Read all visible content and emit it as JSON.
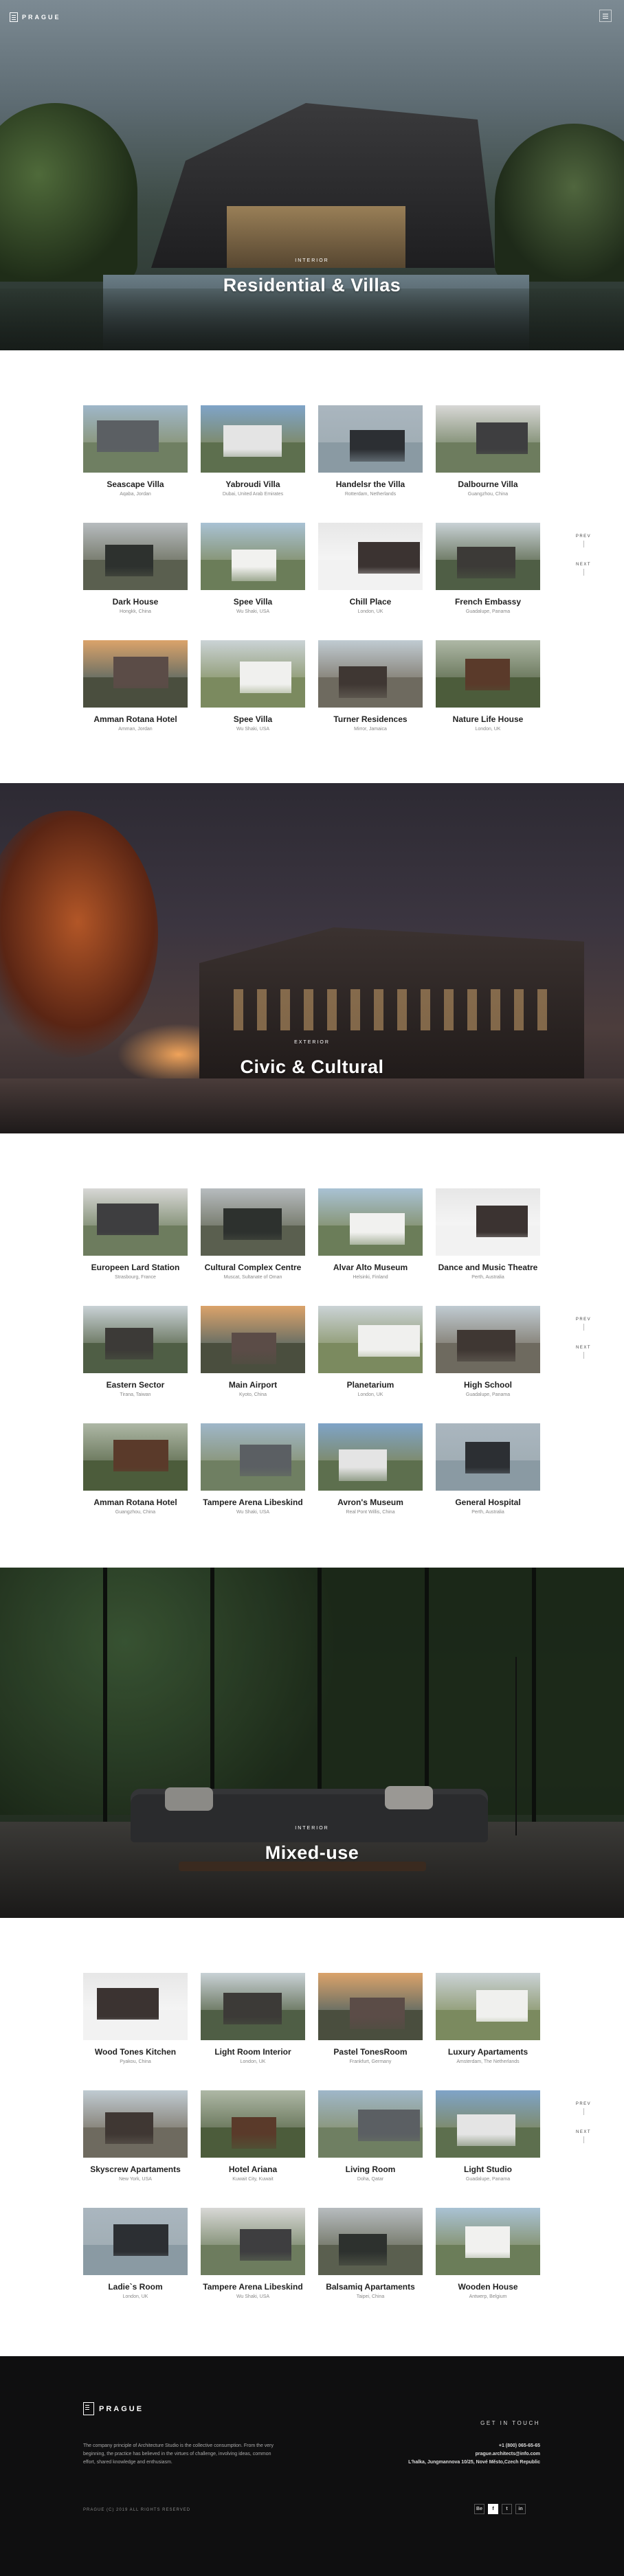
{
  "header": {
    "logo_text": "PRAGUE",
    "menu_icon": "hamburger-icon"
  },
  "sections": [
    {
      "eyebrow": "INTERIOR",
      "title": "Residential & Villas",
      "projects": [
        {
          "title": "Seascape Villa",
          "location": "Aqaba, Jordan"
        },
        {
          "title": "Yabroudi Villa",
          "location": "Dubai, United Arab Emirates"
        },
        {
          "title": "Handelsr the Villa",
          "location": "Rotterdam, Netherlands"
        },
        {
          "title": "Dalbourne Villa",
          "location": "Guangzhou, China"
        },
        {
          "title": "Dark House",
          "location": "Hongkk, China"
        },
        {
          "title": "Spee Villa",
          "location": "Wu Shaki, USA"
        },
        {
          "title": "Chill Place",
          "location": "London, UK"
        },
        {
          "title": "French Embassy",
          "location": "Guadalupe, Panama"
        },
        {
          "title": "Amman Rotana Hotel",
          "location": "Amman, Jordan"
        },
        {
          "title": "Spee Villa",
          "location": "Wu Shaki, USA"
        },
        {
          "title": "Turner Residences",
          "location": "Mirror, Jamaica"
        },
        {
          "title": "Nature Life House",
          "location": "London, UK"
        }
      ]
    },
    {
      "eyebrow": "EXTERIOR",
      "title": "Civic & Cultural",
      "projects": [
        {
          "title": "Europeen Lard Station",
          "location": "Strasbourg, France"
        },
        {
          "title": "Cultural Complex Centre",
          "location": "Muscat, Sultanate of Oman"
        },
        {
          "title": "Alvar Alto Museum",
          "location": "Helsinki, Finland"
        },
        {
          "title": "Dance and Music Theatre",
          "location": "Perth, Australia"
        },
        {
          "title": "Eastern Sector",
          "location": "Tirana, Taiwan"
        },
        {
          "title": "Main Airport",
          "location": "Kyoto, China"
        },
        {
          "title": "Planetarium",
          "location": "London, UK"
        },
        {
          "title": "High School",
          "location": "Guadalupe, Panama"
        },
        {
          "title": "Amman Rotana Hotel",
          "location": "Guangzhou, China"
        },
        {
          "title": "Tampere Arena Libeskind",
          "location": "Wu Shaki, USA"
        },
        {
          "title": "Avron's Museum",
          "location": "Real Pont Willis, China"
        },
        {
          "title": "General Hospital",
          "location": "Perth, Australia"
        }
      ]
    },
    {
      "eyebrow": "INTERIOR",
      "title": "Mixed-use",
      "projects": [
        {
          "title": "Wood Tones Kitchen",
          "location": "Pyakou, China"
        },
        {
          "title": "Light Room Interior",
          "location": "London, UK"
        },
        {
          "title": "Pastel TonesRoom",
          "location": "Frankfurt, Germany"
        },
        {
          "title": "Luxury Apartaments",
          "location": "Amsterdam, The Netherlands"
        },
        {
          "title": "Skyscrew Apartaments",
          "location": "New York, USA"
        },
        {
          "title": "Hotel Ariana",
          "location": "Kuwait City, Kuwait"
        },
        {
          "title": "Living Room",
          "location": "Doha, Qatar"
        },
        {
          "title": "Light Studio",
          "location": "Guadalupe, Panama"
        },
        {
          "title": "Ladie`s Room",
          "location": "London, UK"
        },
        {
          "title": "Tampere Arena Libeskind",
          "location": "Wu Shaki, USA"
        },
        {
          "title": "Balsamiq Apartaments",
          "location": "Taipei, China"
        },
        {
          "title": "Wooden House",
          "location": "Antwerp, Belgium"
        }
      ]
    }
  ],
  "pager": {
    "prev": "PREV",
    "next": "NEXT"
  },
  "footer": {
    "logo_text": "PRAGUE",
    "about": "The company principle of Architecture Studio is the collective consumption. From the very beginning, the practice has believed in the virtues of challenge, involving ideas, common effort, shared knowledge and enthusiasm.",
    "get_in_touch": "GET IN TOUCH",
    "phone": "+1 (800) 065-65-65",
    "email": "prague.architects@info.com",
    "address": "L'halka, Jungmannova 10/25, Nové Město,Czech Republic",
    "copyright": "PRAGUE (C) 2019 ALL RIGHTS RESERVED",
    "social": [
      "Be",
      "f",
      "t",
      "in"
    ]
  },
  "colors": {
    "footer_bg": "#0f0f10",
    "title_text": "#222222",
    "subtitle_text": "#888888"
  }
}
